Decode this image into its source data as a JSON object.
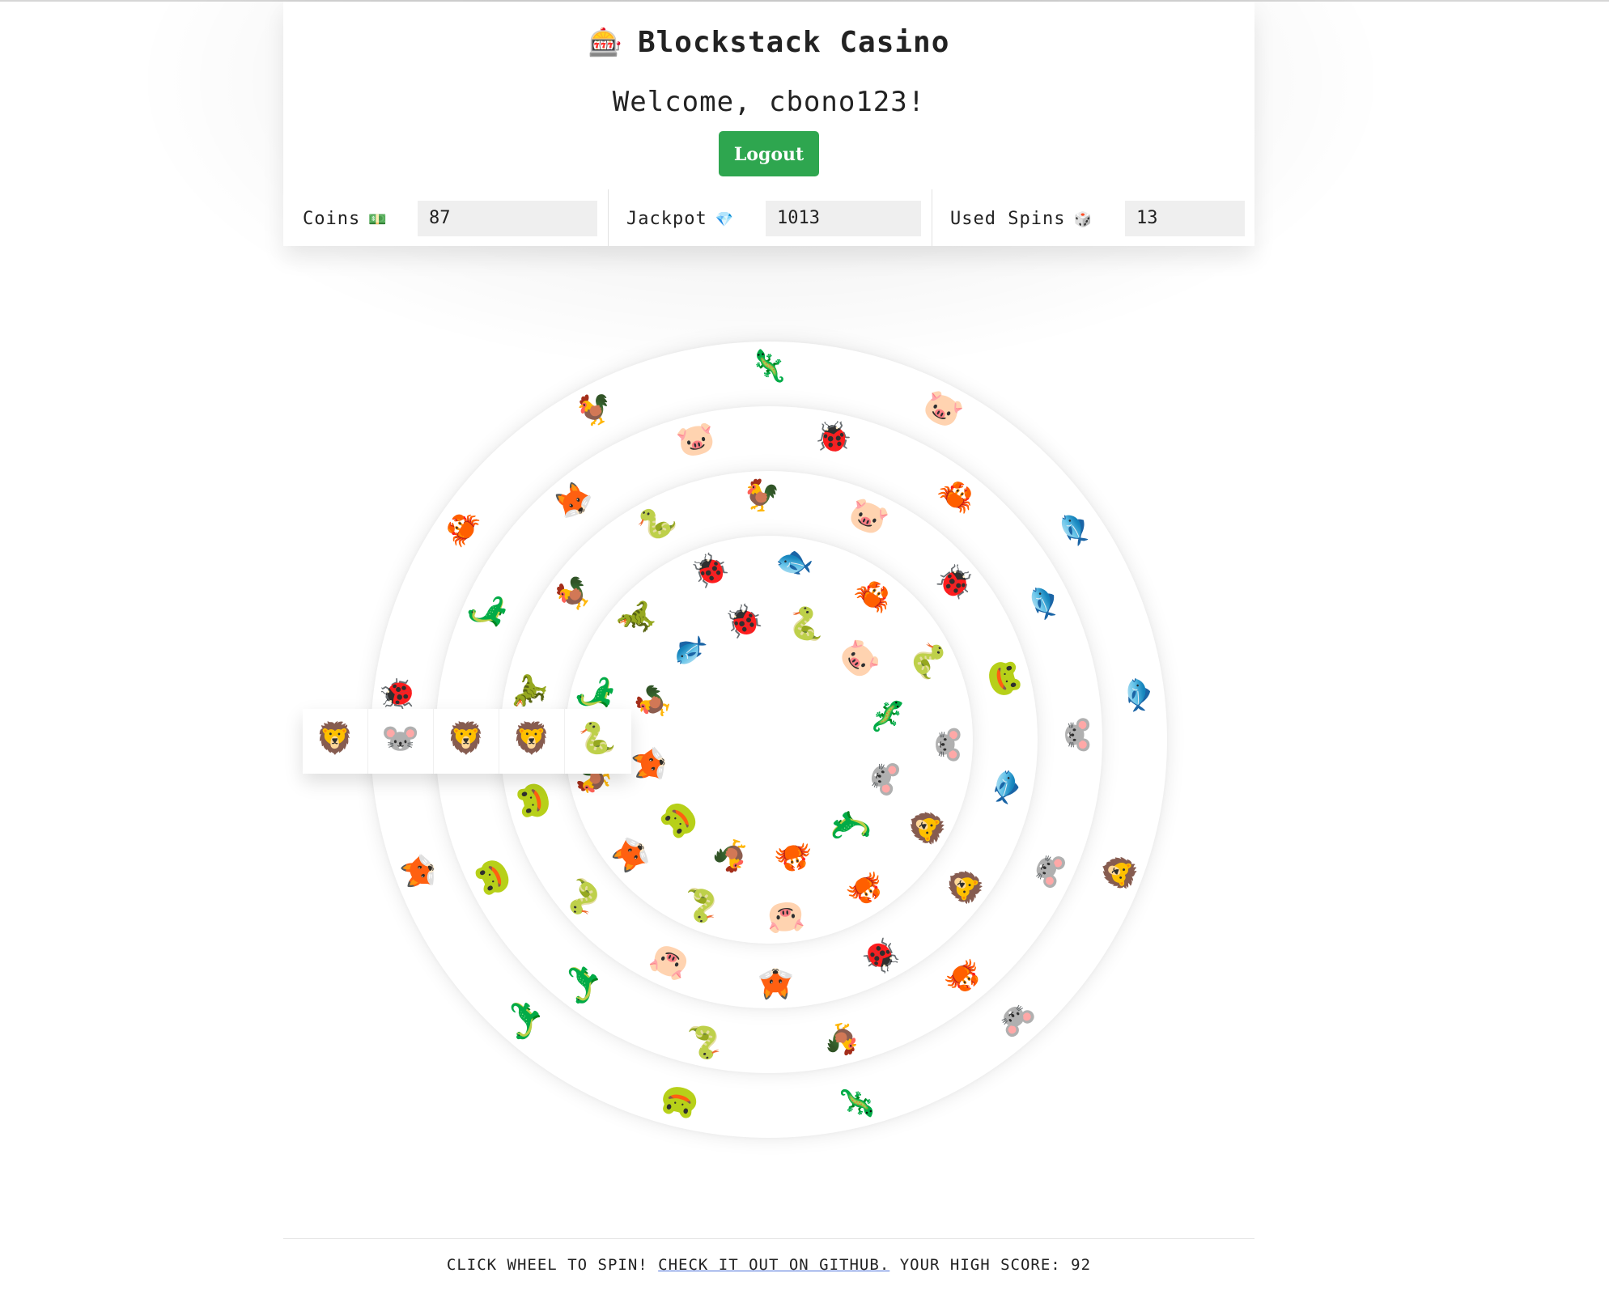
{
  "app": {
    "title": "Blockstack Casino",
    "title_icon": "🎰"
  },
  "welcome": "Welcome, cbono123!",
  "logout_label": "Logout",
  "stats": {
    "coins": {
      "label": "Coins",
      "icon": "💵",
      "value": "87"
    },
    "jackpot": {
      "label": "Jackpot",
      "icon": "💎",
      "value": "1013"
    },
    "spins": {
      "label": "Used Spins",
      "icon": "🎲",
      "value": "13"
    }
  },
  "selection": [
    "🦁",
    "🐭",
    "🦁",
    "🦁",
    "🐍"
  ],
  "rings": [
    [
      "🦎",
      "🐷",
      "🐟",
      "🐟",
      "🦁",
      "🐭",
      "🦎",
      "🐸",
      "🦕",
      "🦊",
      "🐞",
      "🦀",
      "🐓"
    ],
    [
      "🐞",
      "🦀",
      "🐟",
      "🐭",
      "🐭",
      "🦀",
      "🐓",
      "🐍",
      "🦕",
      "🐸",
      "🦊",
      "🦕",
      "🦊",
      "🐷"
    ],
    [
      "🐷",
      "🐞",
      "🐸",
      "🐟",
      "🦁",
      "🐞",
      "🦊",
      "🐷",
      "🐍",
      "🐸",
      "🦖",
      "🐓",
      "🐍",
      "🐓"
    ],
    [
      "🦀",
      "🐍",
      "🐭",
      "🦁",
      "🦀",
      "🐷",
      "🐍",
      "🦊",
      "🐓",
      "🦕",
      "🦖",
      "🐞",
      "🐟"
    ],
    [
      "🐷",
      "🦎",
      "🐭",
      "🦕",
      "🦀",
      "🐓",
      "🐸",
      "🦊",
      "🐓",
      "🐟",
      "🐞",
      "🐍"
    ]
  ],
  "footer": {
    "pre": "Click wheel to spin!",
    "link": "Check it out on GitHub.",
    "post": "Your high score: 92"
  }
}
